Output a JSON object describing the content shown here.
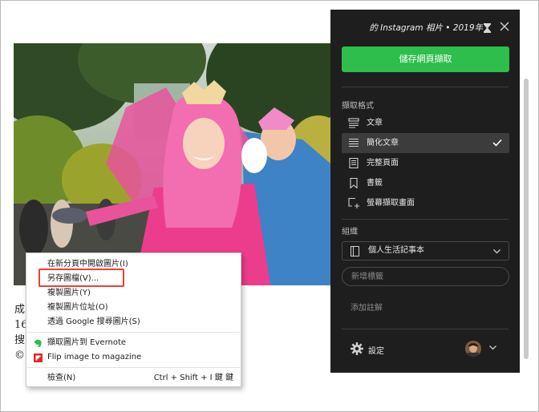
{
  "page": {
    "body_lines": [
      "成",
      "16",
      "搜",
      "©"
    ]
  },
  "context_menu": {
    "items": [
      {
        "label": "在新分頁中開啟圖片(I)"
      },
      {
        "label": "另存圖檔(V)..."
      },
      {
        "label": "複製圖片(Y)"
      },
      {
        "label": "複製圖片位址(O)"
      },
      {
        "label": "透過 Google 搜尋圖片(S)"
      }
    ],
    "ext_items": [
      {
        "label": "擷取圖片到 Evernote",
        "icon": "evernote-icon"
      },
      {
        "label": "Flip image to magazine",
        "icon": "flipboard-icon"
      }
    ],
    "inspect": {
      "label": "檢查(N)",
      "shortcut": "Ctrl + Shift + I 鍵 鍵"
    }
  },
  "clipper": {
    "title": "的 Instagram 相片 • 2019年",
    "save_button": "儲存網頁擷取",
    "format_heading": "擷取格式",
    "formats": [
      {
        "label": "文章",
        "icon": "article-icon"
      },
      {
        "label": "簡化文章",
        "icon": "simplified-article-icon"
      },
      {
        "label": "完整頁面",
        "icon": "full-page-icon"
      },
      {
        "label": "書籤",
        "icon": "bookmark-icon"
      },
      {
        "label": "螢幕擷取畫面",
        "icon": "screenshot-icon"
      }
    ],
    "selected_format": "簡化文章",
    "organize_heading": "組織",
    "notebook": "個人生活記事本",
    "tag_placeholder": "新增標籤",
    "note_placeholder": "添加註解",
    "settings_label": "設定",
    "colors": {
      "accent": "#2dbe4c",
      "panel_bg": "#1e1e1e",
      "highlight_border": "#e8432e"
    }
  }
}
